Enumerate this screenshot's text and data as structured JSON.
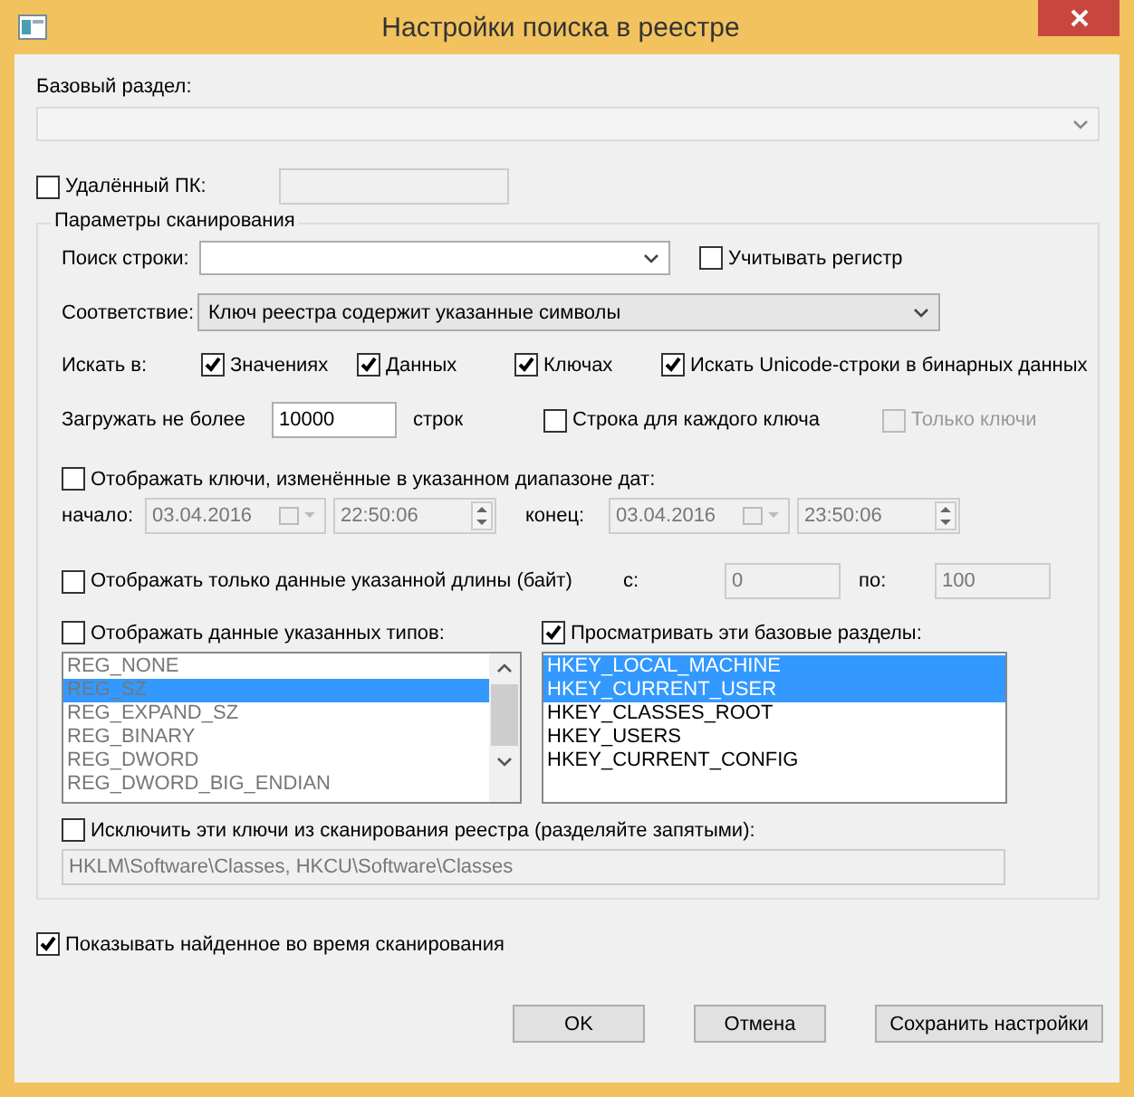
{
  "window": {
    "title": "Настройки поиска в реестре"
  },
  "base_section": {
    "label": "Базовый раздел:",
    "disabled": true
  },
  "remote_pc": {
    "label": "Удалённый ПК:",
    "checked": false
  },
  "scan_params": {
    "title": "Параметры сканирования",
    "search_string": {
      "label": "Поиск строки:"
    },
    "match_case": {
      "label": "Учитывать регистр",
      "checked": false
    },
    "match": {
      "label": "Соответствие:",
      "value": "Ключ реестра содержит указанные символы"
    },
    "search_in": {
      "label": "Искать в:",
      "options": [
        {
          "label": "Значениях",
          "checked": true
        },
        {
          "label": "Данных",
          "checked": true
        },
        {
          "label": "Ключах",
          "checked": true
        },
        {
          "label": "Искать Unicode-строки в бинарных данных",
          "checked": true
        }
      ]
    },
    "load_limit": {
      "label": "Загружать не более",
      "value": "10000",
      "unit": "строк"
    },
    "row_per_key": {
      "label": "Строка для каждого ключа",
      "checked": false
    },
    "keys_only": {
      "label": "Только ключи",
      "checked": false,
      "disabled": true
    },
    "date_range": {
      "label": "Отображать ключи, изменённые в указанном диапазоне дат:",
      "checked": false,
      "start": {
        "label": "начало:",
        "date": "03.04.2016",
        "time": "22:50:06"
      },
      "end": {
        "label": "конец:",
        "date": "03.04.2016",
        "time": "23:50:06"
      }
    },
    "length": {
      "label": "Отображать только данные указанной длины (байт)",
      "checked": false,
      "from": {
        "label": "с:",
        "value": "0"
      },
      "to": {
        "label": "по:",
        "value": "100"
      }
    },
    "types": {
      "label": "Отображать данные указанных типов:",
      "checked": false,
      "items": [
        {
          "text": "REG_NONE",
          "selected": false
        },
        {
          "text": "REG_SZ",
          "selected": true
        },
        {
          "text": "REG_EXPAND_SZ",
          "selected": false
        },
        {
          "text": "REG_BINARY",
          "selected": false
        },
        {
          "text": "REG_DWORD",
          "selected": false
        },
        {
          "text": "REG_DWORD_BIG_ENDIAN",
          "selected": false
        }
      ]
    },
    "base_sections": {
      "label": "Просматривать эти базовые разделы:",
      "checked": true,
      "items": [
        {
          "text": "HKEY_LOCAL_MACHINE",
          "selected": true
        },
        {
          "text": "HKEY_CURRENT_USER",
          "selected": true
        },
        {
          "text": "HKEY_CLASSES_ROOT",
          "selected": false
        },
        {
          "text": "HKEY_USERS",
          "selected": false
        },
        {
          "text": "HKEY_CURRENT_CONFIG",
          "selected": false
        }
      ]
    },
    "exclude": {
      "label": "Исключить эти ключи из сканирования реестра (разделяйте запятыми):",
      "checked": false,
      "value": "HKLM\\Software\\Classes, HKCU\\Software\\Classes"
    }
  },
  "show_found": {
    "label": "Показывать найденное во время сканирования",
    "checked": true
  },
  "buttons": [
    {
      "label": "OK"
    },
    {
      "label": "Отмена"
    },
    {
      "label": "Сохранить настройки"
    }
  ]
}
